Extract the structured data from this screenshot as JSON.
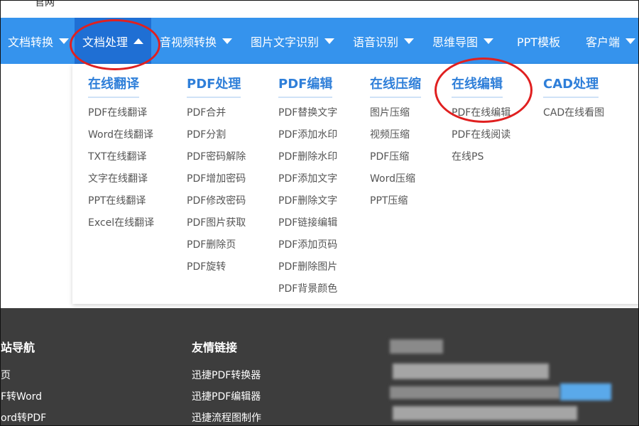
{
  "top_cut_text": "官网",
  "nav": {
    "items": [
      {
        "label": "文档转换"
      },
      {
        "label": "文档处理"
      },
      {
        "label": "音视频转换"
      },
      {
        "label": "图片文字识别"
      },
      {
        "label": "语音识别"
      },
      {
        "label": "思维导图"
      },
      {
        "label": "PPT模板"
      },
      {
        "label": "客户端"
      }
    ]
  },
  "menu": {
    "columns": [
      {
        "title": "在线翻译",
        "items": [
          "PDF在线翻译",
          "Word在线翻译",
          "TXT在线翻译",
          "文字在线翻译",
          "PPT在线翻译",
          "Excel在线翻译"
        ]
      },
      {
        "title": "PDF处理",
        "items": [
          "PDF合并",
          "PDF分割",
          "PDF密码解除",
          "PDF增加密码",
          "PDF修改密码",
          "PDF图片获取",
          "PDF删除页",
          "PDF旋转"
        ]
      },
      {
        "title": "PDF编辑",
        "items": [
          "PDF替换文字",
          "PDF添加水印",
          "PDF删除水印",
          "PDF添加文字",
          "PDF删除文字",
          "PDF链接编辑",
          "PDF添加页码",
          "PDF删除图片",
          "PDF背景颜色"
        ]
      },
      {
        "title": "在线压缩",
        "items": [
          "图片压缩",
          "视频压缩",
          "PDF压缩",
          "Word压缩",
          "PPT压缩"
        ]
      },
      {
        "title": "在线编辑",
        "items": [
          "PDF在线编辑",
          "PDF在线阅读",
          "在线PS"
        ]
      },
      {
        "title": "CAD处理",
        "items": [
          "CAD在线看图"
        ]
      }
    ]
  },
  "footer": {
    "site_nav": {
      "title": "站导航",
      "items": [
        "页",
        "F转Word",
        "ord转PDF"
      ]
    },
    "links": {
      "title": "友情链接",
      "items": [
        "迅捷PDF转换器",
        "迅捷PDF编辑器",
        "迅捷流程图制作"
      ]
    }
  },
  "colors": {
    "nav_bg": "#3593ed",
    "nav_active": "#1f6fd4",
    "menu_head": "#2f7fd9",
    "highlight_circle": "#e02020",
    "footer_bg": "#3d3d3d"
  }
}
